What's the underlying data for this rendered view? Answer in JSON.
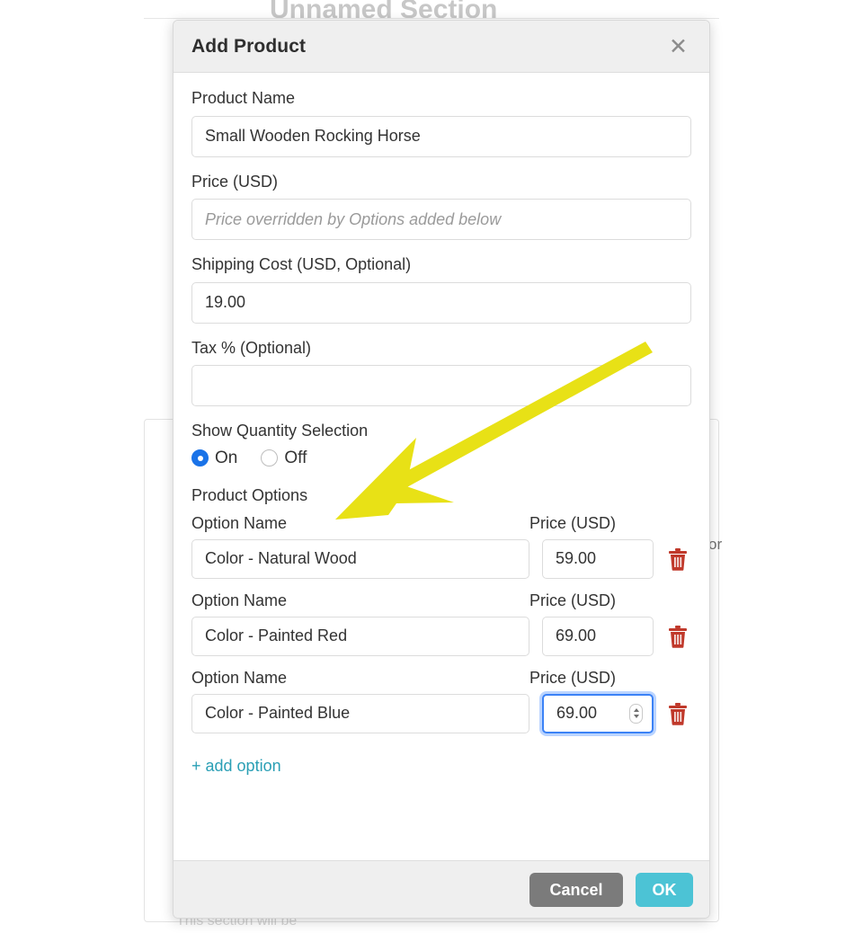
{
  "background": {
    "page_title": "Unnamed Section",
    "side_text": "or",
    "bottom_text": "This section will be"
  },
  "modal": {
    "title": "Add Product",
    "close_icon": "close-icon",
    "fields": {
      "product_name": {
        "label": "Product Name",
        "value": "Small Wooden Rocking Horse",
        "placeholder": ""
      },
      "price": {
        "label": "Price (USD)",
        "value": "",
        "placeholder": "Price overridden by Options added below"
      },
      "shipping": {
        "label": "Shipping Cost (USD, Optional)",
        "value": "19.00",
        "placeholder": ""
      },
      "tax": {
        "label": "Tax % (Optional)",
        "value": "",
        "placeholder": ""
      }
    },
    "quantity": {
      "label": "Show Quantity Selection",
      "options": [
        {
          "label": "On",
          "checked": true
        },
        {
          "label": "Off",
          "checked": false
        }
      ]
    },
    "product_options": {
      "section_label": "Product Options",
      "name_header": "Option Name",
      "price_header": "Price (USD)",
      "delete_icon": "trash-icon",
      "rows": [
        {
          "name": "Color - Natural Wood",
          "price": "59.00",
          "focused": false
        },
        {
          "name": "Color - Painted Red",
          "price": "69.00",
          "focused": false
        },
        {
          "name": "Color - Painted Blue",
          "price": "69.00",
          "focused": true
        }
      ],
      "add_label": "+ add option"
    },
    "footer": {
      "cancel_label": "Cancel",
      "ok_label": "OK"
    }
  },
  "annotation": {
    "arrow_color": "#e8e116",
    "arrow_name": "highlight-arrow"
  },
  "colors": {
    "accent_ok": "#4cc3d5",
    "accent_link": "#2a9fb5",
    "radio_on": "#1a73e8",
    "delete": "#c0392b",
    "cancel": "#7b7b7b",
    "header_bg": "#efefef"
  }
}
